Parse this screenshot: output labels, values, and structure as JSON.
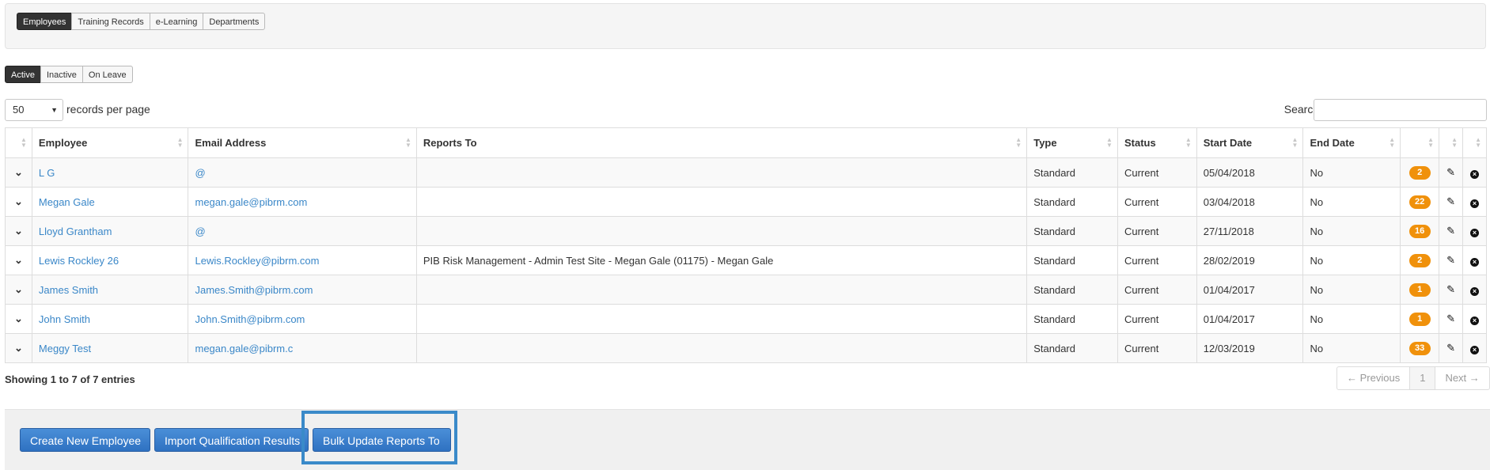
{
  "top_tabs": [
    "Employees",
    "Training Records",
    "e-Learning",
    "Departments"
  ],
  "status_filters": [
    "Active",
    "Inactive",
    "On Leave"
  ],
  "length": {
    "value": "50",
    "label": "records per page"
  },
  "search": {
    "label": "Search:",
    "value": ""
  },
  "columns": [
    "",
    "Employee",
    "Email Address",
    "Reports To",
    "Type",
    "Status",
    "Start Date",
    "End Date",
    "",
    "",
    ""
  ],
  "rows": [
    {
      "employee": "L G",
      "email": "@",
      "reports_to": "",
      "type": "Standard",
      "status": "Current",
      "start": "05/04/2018",
      "end": "No",
      "count": "2"
    },
    {
      "employee": "Megan Gale",
      "email": "megan.gale@pibrm.com",
      "reports_to": "",
      "type": "Standard",
      "status": "Current",
      "start": "03/04/2018",
      "end": "No",
      "count": "22"
    },
    {
      "employee": "Lloyd Grantham",
      "email": "@",
      "reports_to": "",
      "type": "Standard",
      "status": "Current",
      "start": "27/11/2018",
      "end": "No",
      "count": "16"
    },
    {
      "employee": "Lewis Rockley 26",
      "email": "Lewis.Rockley@pibrm.com",
      "reports_to": "PIB Risk Management - Admin Test Site - Megan Gale (01175) - Megan Gale",
      "type": "Standard",
      "status": "Current",
      "start": "28/02/2019",
      "end": "No",
      "count": "2"
    },
    {
      "employee": "James Smith",
      "email": "James.Smith@pibrm.com",
      "reports_to": "",
      "type": "Standard",
      "status": "Current",
      "start": "01/04/2017",
      "end": "No",
      "count": "1"
    },
    {
      "employee": "John Smith",
      "email": "John.Smith@pibrm.com",
      "reports_to": "",
      "type": "Standard",
      "status": "Current",
      "start": "01/04/2017",
      "end": "No",
      "count": "1"
    },
    {
      "employee": "Meggy Test",
      "email": "megan.gale@pibrm.c",
      "reports_to": "",
      "type": "Standard",
      "status": "Current",
      "start": "12/03/2019",
      "end": "No",
      "count": "33"
    }
  ],
  "info": "Showing 1 to 7 of 7 entries",
  "pager": {
    "prev": "← Previous",
    "page": "1",
    "next": "Next →"
  },
  "actions": {
    "create": "Create New Employee",
    "import": "Import Qualification Results",
    "bulk": "Bulk Update Reports To"
  },
  "colors": {
    "accent": "#2f71c1",
    "badge": "#f0910b",
    "highlight": "#3a8ac9"
  },
  "icons": {
    "expand": "chevron-down-icon",
    "edit": "pencil-icon",
    "delete": "close-circle-icon"
  }
}
